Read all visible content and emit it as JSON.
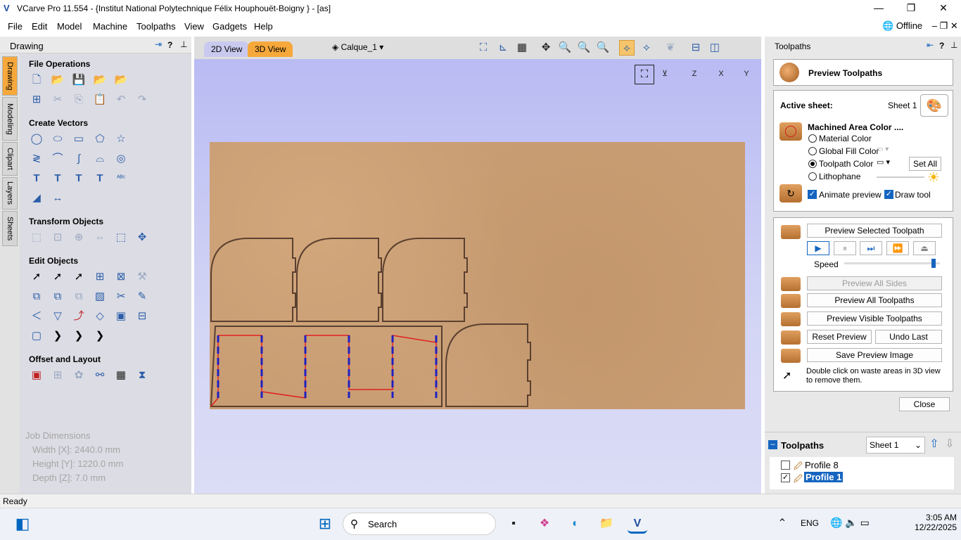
{
  "window": {
    "title": "VCarve Pro 11.554 - {Institut National Polytechnique Félix Houphouët-Boigny } - [as]",
    "minimize": "—",
    "maximize": "❐",
    "close": "✕"
  },
  "menu": [
    "File",
    "Edit",
    "Model",
    "Machine",
    "Toolpaths",
    "View",
    "Gadgets",
    "Help"
  ],
  "offline": "Offline",
  "left_panel": {
    "title": "Drawing",
    "tabs": [
      "Drawing",
      "Modeling",
      "Clipart",
      "Layers",
      "Sheets"
    ],
    "sections": [
      "File Operations",
      "Create Vectors",
      "Transform Objects",
      "Edit Objects",
      "Offset and Layout"
    ],
    "job_dimensions": {
      "title": "Job Dimensions",
      "width": "Width  [X]: 2440.0 mm",
      "height": "Height [Y]: 1220.0 mm",
      "depth": "Depth  [Z]: 7.0 mm"
    }
  },
  "view": {
    "tab_2d": "2D View",
    "tab_3d": "3D View",
    "layer": "Calque_1"
  },
  "right_panel": {
    "title": "Toolpaths",
    "preview_title": "Preview Toolpaths",
    "active_sheet_label": "Active sheet:",
    "active_sheet_value": "Sheet 1",
    "machined_area": "Machined Area Color ....",
    "options": [
      "Material Color",
      "Global Fill Color",
      "Toolpath Color",
      "Lithophane"
    ],
    "selected_option": "Toolpath Color",
    "set_all": "Set All",
    "animate_preview": "Animate preview",
    "draw_tool": "Draw tool",
    "preview_selected": "Preview Selected Toolpath",
    "speed": "Speed",
    "speed_level": 0.95,
    "preview_all_sides": "Preview All Sides",
    "preview_all_toolpaths": "Preview All Toolpaths",
    "preview_visible_toolpaths": "Preview Visible Toolpaths",
    "reset_preview": "Reset Preview",
    "undo_last": "Undo Last",
    "save_preview_image": "Save Preview Image",
    "hint": "Double click on waste areas in 3D view to remove them.",
    "close": "Close",
    "list_title": "Toolpaths",
    "sheet_select": "Sheet 1",
    "items": [
      {
        "label": "Profile 8",
        "checked": false
      },
      {
        "label": "Profile 1",
        "checked": true
      }
    ]
  },
  "status": "Ready",
  "taskbar": {
    "search": "Search",
    "lang": "ENG",
    "time": "3:05 AM",
    "date": "12/22/2025"
  },
  "colors": {
    "accent": "#1565c0",
    "tab_active": "#f6a83b",
    "board": "#c99d73",
    "toolpath": "#e02020",
    "plunge": "#2020c0"
  }
}
